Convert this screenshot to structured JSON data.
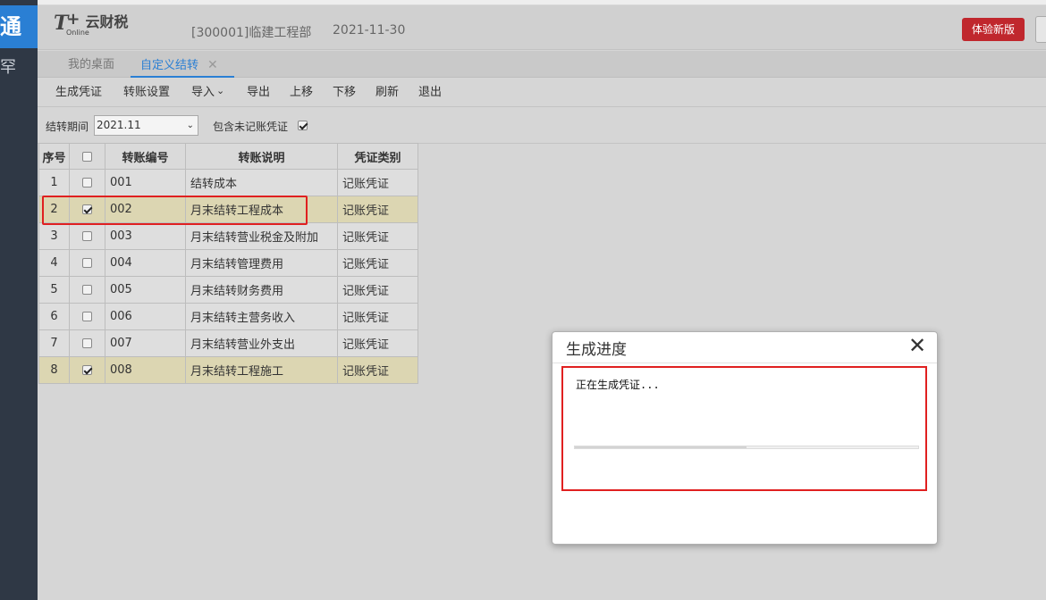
{
  "nav": {
    "brand_char": "通",
    "side_char": "罕"
  },
  "header": {
    "logo_t": "T",
    "logo_plus": "+",
    "logo_online": "Online",
    "app_name": "云财税",
    "org": "[300001]临建工程部",
    "date": "2021-11-30",
    "new_version_btn": "体验新版"
  },
  "tabs": [
    {
      "label": "我的桌面"
    },
    {
      "label": "自定义结转",
      "close": "✕"
    }
  ],
  "toolbar": {
    "generate": "生成凭证",
    "settings": "转账设置",
    "import": "导入",
    "import_arrow": "⌄",
    "export": "导出",
    "move_up": "上移",
    "move_down": "下移",
    "refresh": "刷新",
    "exit": "退出"
  },
  "filter": {
    "period_label": "结转期间",
    "period_value": "2021.11",
    "select_arrow": "⌄",
    "include_label": "包含未记账凭证",
    "include_checked": true
  },
  "table": {
    "headers": [
      "序号",
      "",
      "转账编号",
      "转账说明",
      "凭证类别"
    ],
    "rows": [
      {
        "no": "1",
        "checked": false,
        "code": "001",
        "desc": "结转成本",
        "type": "记账凭证"
      },
      {
        "no": "2",
        "checked": true,
        "code": "002",
        "desc": "月末结转工程成本",
        "type": "记账凭证"
      },
      {
        "no": "3",
        "checked": false,
        "code": "003",
        "desc": "月末结转营业税金及附加",
        "type": "记账凭证"
      },
      {
        "no": "4",
        "checked": false,
        "code": "004",
        "desc": "月末结转管理费用",
        "type": "记账凭证"
      },
      {
        "no": "5",
        "checked": false,
        "code": "005",
        "desc": "月末结转财务费用",
        "type": "记账凭证"
      },
      {
        "no": "6",
        "checked": false,
        "code": "006",
        "desc": "月末结转主营务收入",
        "type": "记账凭证"
      },
      {
        "no": "7",
        "checked": false,
        "code": "007",
        "desc": "月末结转营业外支出",
        "type": "记账凭证"
      },
      {
        "no": "8",
        "checked": true,
        "code": "008",
        "desc": "月末结转工程施工",
        "type": "记账凭证"
      }
    ]
  },
  "dialog": {
    "title": "生成进度",
    "close": "✕",
    "status": "正在生成凭证...",
    "progress": 0.5
  }
}
